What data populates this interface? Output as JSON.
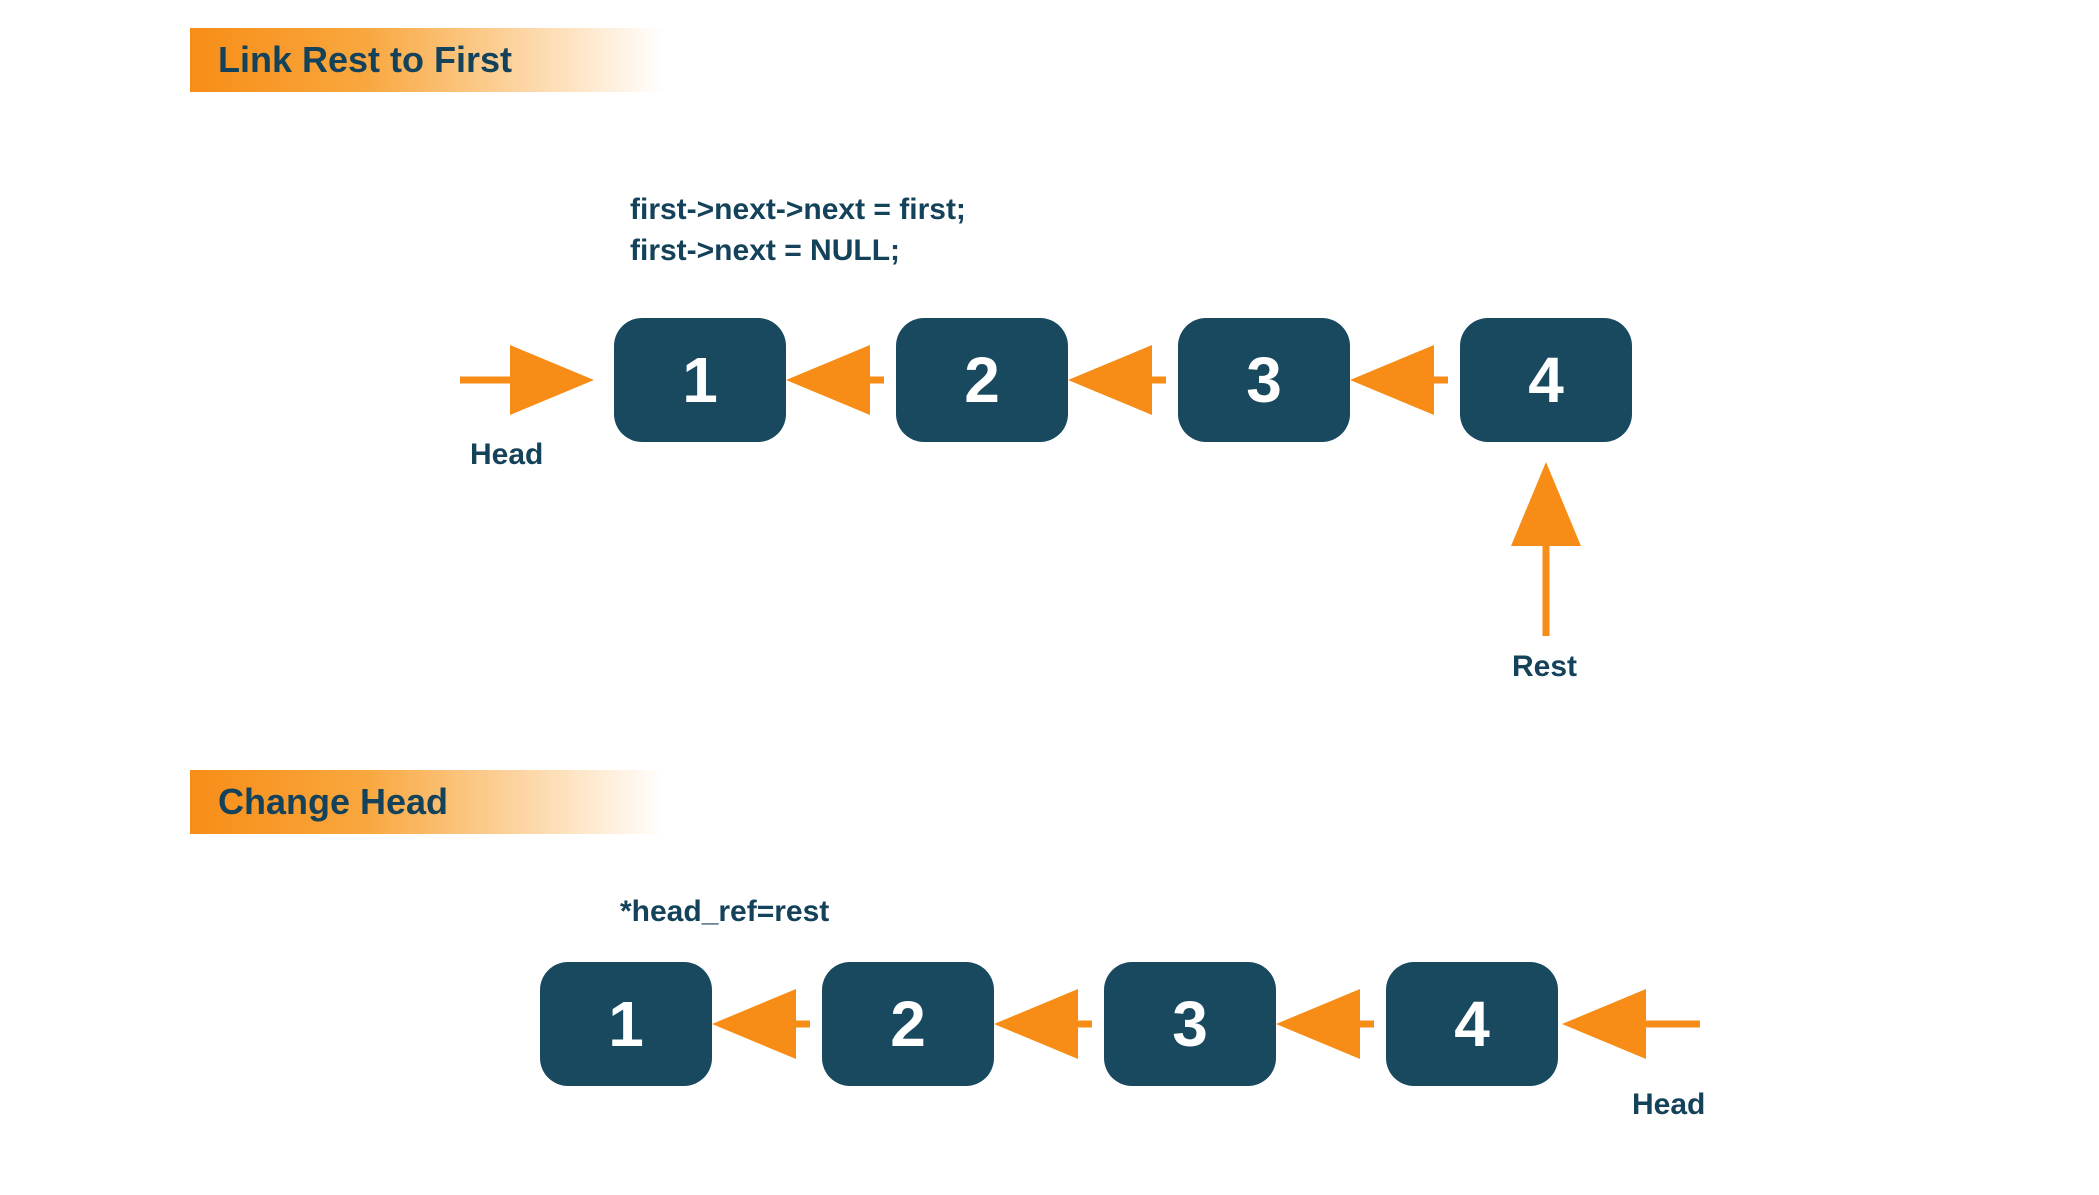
{
  "section1": {
    "title": "Link Rest to First",
    "code1": "first->next->next = first;",
    "code2": "first->next = NULL;",
    "head_label": "Head",
    "rest_label": "Rest",
    "nodes": [
      "1",
      "2",
      "3",
      "4"
    ]
  },
  "section2": {
    "title": "Change Head",
    "code": "*head_ref=rest",
    "head_label": "Head",
    "nodes": [
      "1",
      "2",
      "3",
      "4"
    ]
  },
  "colors": {
    "node_bg": "#18495f",
    "arrow": "#f78d17",
    "text": "#13425a"
  }
}
